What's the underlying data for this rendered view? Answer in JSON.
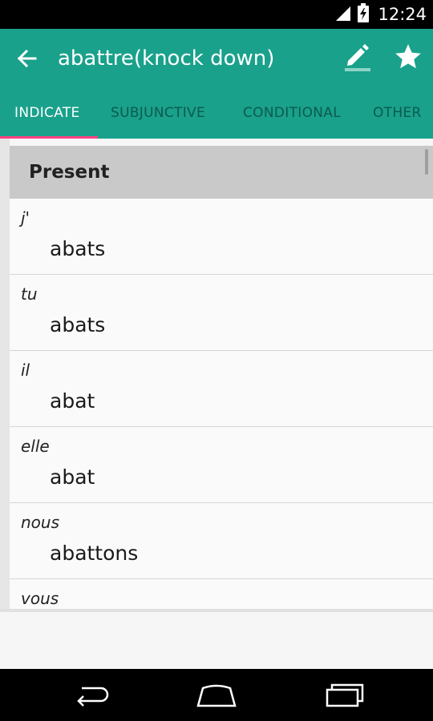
{
  "status_bar": {
    "time": "12:24"
  },
  "toolbar": {
    "title": "abattre(knock down)"
  },
  "tabs": [
    {
      "label": "INDICATE",
      "active": true
    },
    {
      "label": "SUBJUNCTIVE",
      "active": false
    },
    {
      "label": "CONDITIONAL",
      "active": false
    },
    {
      "label": "OTHER",
      "active": false
    }
  ],
  "section": {
    "title": "Present"
  },
  "conjugations": [
    {
      "pronoun": "j'",
      "form": "abats"
    },
    {
      "pronoun": "tu",
      "form": "abats"
    },
    {
      "pronoun": "il",
      "form": "abat"
    },
    {
      "pronoun": "elle",
      "form": "abat"
    },
    {
      "pronoun": "nous",
      "form": "abattons"
    },
    {
      "pronoun": "vous",
      "form": ""
    }
  ],
  "colors": {
    "primary": "#19a18b",
    "accent": "#ff4081",
    "inactive_tab": "#0c5a4e"
  },
  "icons": [
    "signal-icon",
    "battery-icon",
    "back-arrow-icon",
    "edit-icon",
    "star-icon",
    "nav-back-icon",
    "nav-home-icon",
    "nav-recents-icon"
  ]
}
